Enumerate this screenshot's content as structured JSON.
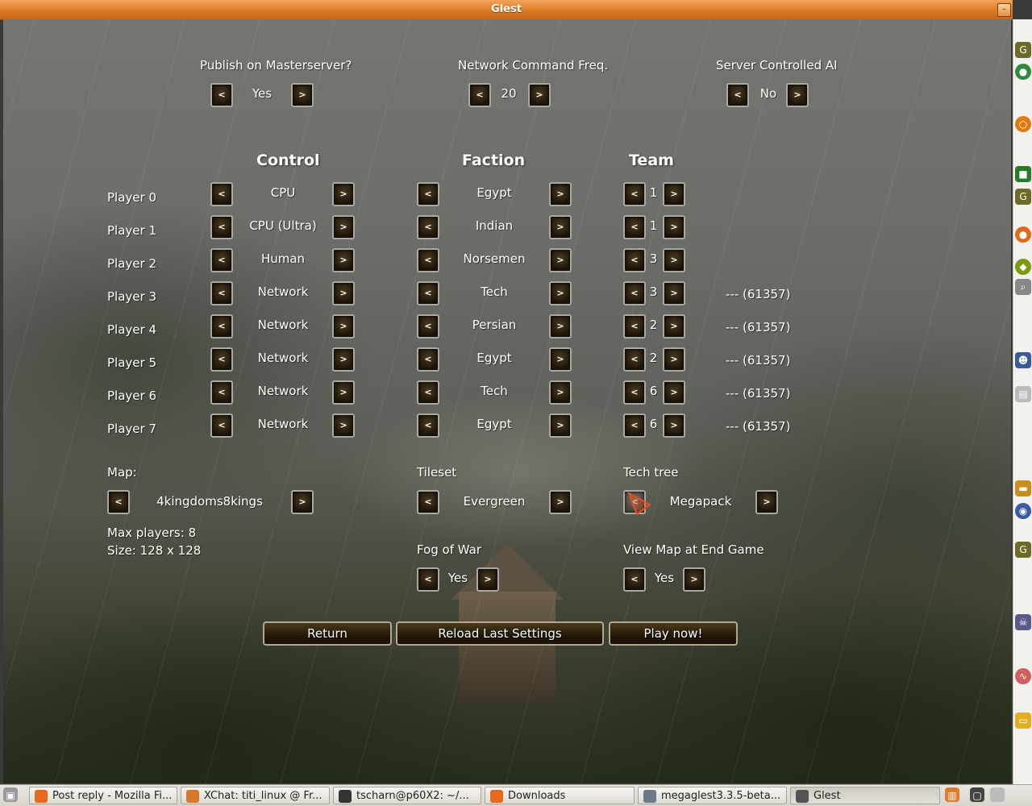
{
  "window": {
    "title": "Glest",
    "min_label": "–"
  },
  "top_options": {
    "publish": {
      "label": "Publish on Masterserver?",
      "value": "Yes"
    },
    "freq": {
      "label": "Network Command Freq.",
      "value": "20"
    },
    "ai": {
      "label": "Server Controlled AI",
      "value": "No"
    }
  },
  "headers": {
    "control": "Control",
    "faction": "Faction",
    "team": "Team"
  },
  "arrows": {
    "left": "<",
    "right": ">"
  },
  "players": [
    {
      "label": "Player  0",
      "control": "CPU",
      "faction": "Egypt",
      "team": "1",
      "net": ""
    },
    {
      "label": "Player  1",
      "control": "CPU (Ultra)",
      "faction": "Indian",
      "team": "1",
      "net": ""
    },
    {
      "label": "Player  2",
      "control": "Human",
      "faction": "Norsemen",
      "team": "3",
      "net": ""
    },
    {
      "label": "Player  3",
      "control": "Network",
      "faction": "Tech",
      "team": "3",
      "net": "--- (61357)"
    },
    {
      "label": "Player  4",
      "control": "Network",
      "faction": "Persian",
      "team": "2",
      "net": "--- (61357)"
    },
    {
      "label": "Player  5",
      "control": "Network",
      "faction": "Egypt",
      "team": "2",
      "net": "--- (61357)"
    },
    {
      "label": "Player  6",
      "control": "Network",
      "faction": "Tech",
      "team": "6",
      "net": "--- (61357)"
    },
    {
      "label": "Player  7",
      "control": "Network",
      "faction": "Egypt",
      "team": "6",
      "net": "--- (61357)"
    }
  ],
  "map": {
    "label": "Map:",
    "value": "4kingdoms8kings",
    "max_players": "Max players: 8",
    "size": "Size: 128 x 128"
  },
  "tileset": {
    "label": "Tileset",
    "value": "Evergreen"
  },
  "techtree": {
    "label": "Tech tree",
    "value": "Megapack"
  },
  "fog": {
    "label": "Fog of War",
    "value": "Yes"
  },
  "viewmap": {
    "label": "View Map at End Game",
    "value": "Yes"
  },
  "buttons": {
    "return": "Return",
    "reload": "Reload Last Settings",
    "play": "Play now!"
  },
  "taskbar": [
    {
      "label": "Post reply - Mozilla Fi...",
      "icon": "firefox-icon",
      "color": "#e66a1c"
    },
    {
      "label": "XChat: titi_linux @ Fr...",
      "icon": "xchat-icon",
      "color": "#d9772a"
    },
    {
      "label": "tscharn@p60X2: ~/...",
      "icon": "terminal-icon",
      "color": "#333333"
    },
    {
      "label": "Downloads",
      "icon": "firefox-icon",
      "color": "#e66a1c"
    },
    {
      "label": "megaglest3.3.5-beta...",
      "icon": "file-manager-icon",
      "color": "#6c7a8c"
    },
    {
      "label": "Glest",
      "icon": "window-icon",
      "color": "#555555"
    }
  ]
}
